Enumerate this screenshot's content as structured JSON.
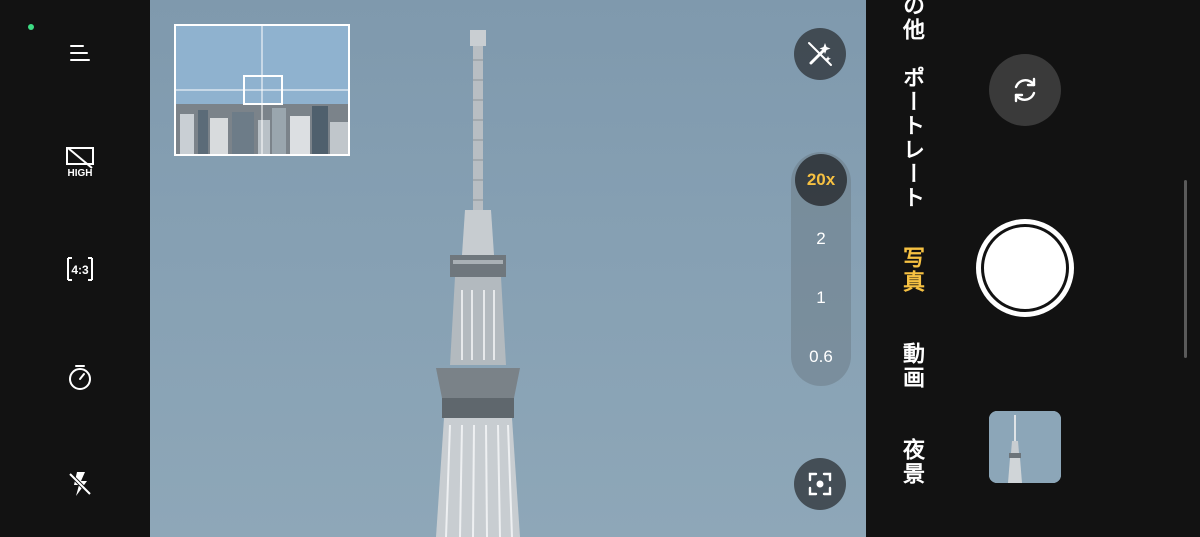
{
  "left_rail": {
    "items": [
      {
        "icon": "menu-icon"
      },
      {
        "icon": "hdr-off-icon",
        "label": "HIGH"
      },
      {
        "icon": "aspect-ratio-icon",
        "label": "4:3"
      },
      {
        "icon": "timer-icon"
      },
      {
        "icon": "flash-off-icon"
      }
    ]
  },
  "zoom": {
    "levels": [
      "20x",
      "2",
      "1",
      "0.6"
    ],
    "selected": "20x"
  },
  "modes": {
    "items": [
      {
        "label": "その他",
        "active": false
      },
      {
        "label": "ポートレート",
        "active": false
      },
      {
        "label": "写真",
        "active": true
      },
      {
        "label": "動画",
        "active": false
      },
      {
        "label": "夜景",
        "active": false
      }
    ]
  },
  "colors": {
    "accent": "#f6c142",
    "background": "#121212",
    "status_dot": "#3ddc84"
  },
  "icons": {
    "ai_scene": "magic-wand-icon",
    "focus": "scan-focus-icon",
    "switch_camera": "switch-camera-icon"
  }
}
